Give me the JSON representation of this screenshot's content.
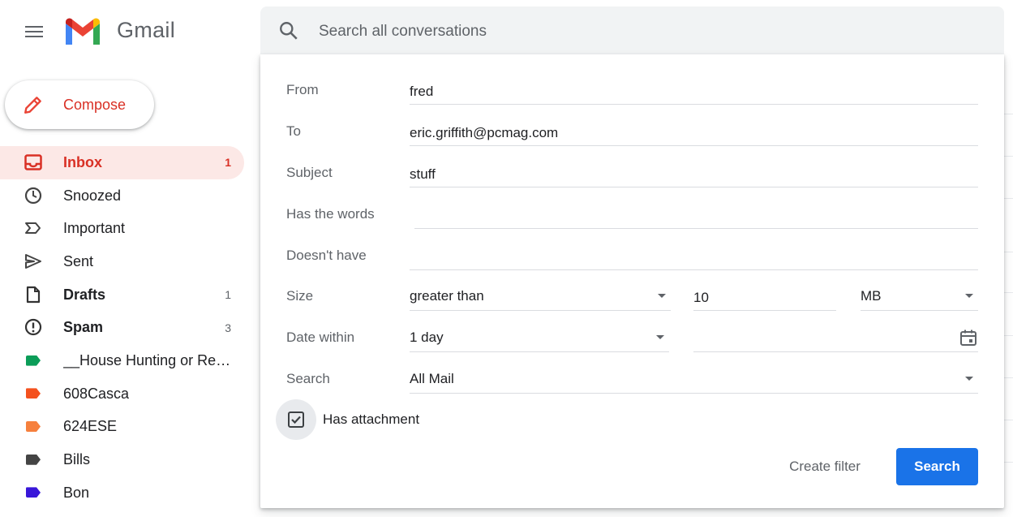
{
  "app": {
    "brand": "Gmail"
  },
  "search": {
    "placeholder": "Search all conversations"
  },
  "compose": {
    "label": "Compose"
  },
  "nav": {
    "inbox": {
      "label": "Inbox",
      "count": "1"
    },
    "snoozed": {
      "label": "Snoozed"
    },
    "important": {
      "label": "Important"
    },
    "sent": {
      "label": "Sent"
    },
    "drafts": {
      "label": "Drafts",
      "count": "1"
    },
    "spam": {
      "label": "Spam",
      "count": "3"
    },
    "labels": [
      {
        "label": "__House Hunting or ReF…",
        "color": "#0b9d58"
      },
      {
        "label": "608Casca",
        "color": "#f4511e"
      },
      {
        "label": "624ESE",
        "color": "#f6803d"
      },
      {
        "label": "Bills",
        "color": "#444444"
      },
      {
        "label": "Bon",
        "color": "#3816d9"
      }
    ]
  },
  "panel": {
    "from": {
      "label": "From",
      "value": "fred"
    },
    "to": {
      "label": "To",
      "value": "eric.griffith@pcmag.com"
    },
    "subject": {
      "label": "Subject",
      "value": "stuff"
    },
    "has_words": {
      "label": "Has the words",
      "value": ""
    },
    "doesnt_have": {
      "label": "Doesn't have",
      "value": ""
    },
    "size": {
      "label": "Size",
      "comparator": "greater than",
      "amount": "10",
      "unit": "MB"
    },
    "date_within": {
      "label": "Date within",
      "value": "1 day",
      "date": ""
    },
    "search_in": {
      "label": "Search",
      "value": "All Mail"
    },
    "has_attachment": {
      "label": "Has attachment",
      "checked": true
    },
    "create_filter_label": "Create filter",
    "search_button_label": "Search"
  },
  "colors": {
    "accent": "#1a73e8",
    "inbox_highlight": "#fce8e6",
    "inbox_text": "#d93025"
  }
}
